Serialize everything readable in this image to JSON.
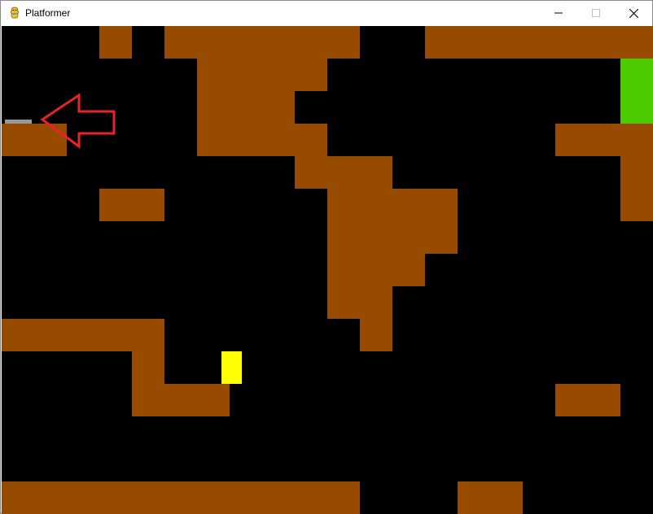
{
  "window": {
    "title": "Platformer",
    "icon": "pygame-snake-icon",
    "controls": [
      "minimize-icon",
      "maximize-icon",
      "close-icon"
    ]
  },
  "game": {
    "background_color": "#000000",
    "wall_color": "#964B00",
    "player_color": "#FFFF00",
    "exit_color": "#4CCB00",
    "marker_color": "#999999",
    "annotation_color": "#E8232A",
    "annotation_icon": "left-arrow-outline-icon"
  }
}
